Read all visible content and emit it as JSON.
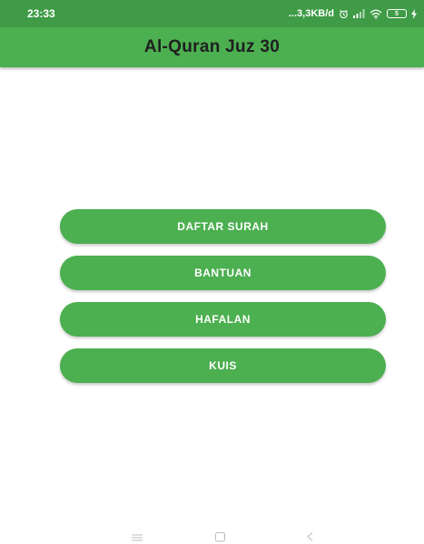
{
  "status_bar": {
    "time": "23:33",
    "network_speed": "...3,3KB/d",
    "battery_level": "5",
    "icons": [
      "alarm-icon",
      "signal-icon",
      "wifi-icon",
      "battery-icon",
      "charging-icon"
    ]
  },
  "app_bar": {
    "title": "Al-Quran Juz 30"
  },
  "menu": {
    "items": [
      {
        "label": "DAFTAR SURAH"
      },
      {
        "label": "BANTUAN"
      },
      {
        "label": "HAFALAN"
      },
      {
        "label": "KUIS"
      }
    ]
  },
  "nav_bar": {
    "icons": [
      "menu-icon",
      "home-icon",
      "back-icon"
    ]
  },
  "colors": {
    "primary": "#4caf50",
    "primary_dark": "#3f9b46",
    "button_text": "#ffffff",
    "title_text": "#1f1f1f"
  }
}
